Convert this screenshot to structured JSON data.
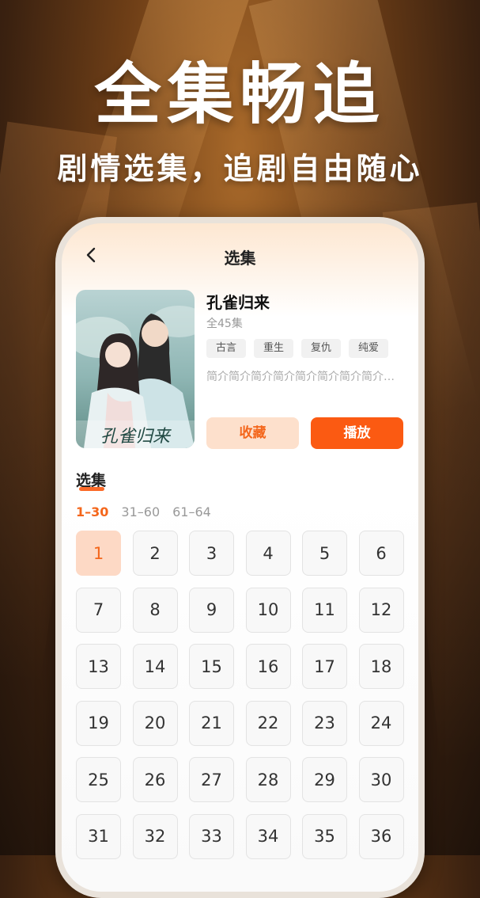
{
  "promo": {
    "title": "全集畅追",
    "subtitle": "剧情选集，追剧自由随心"
  },
  "nav": {
    "title": "选集",
    "back_icon": "chevron-left-icon"
  },
  "drama": {
    "title": "孔雀归来",
    "episodes": "全45集",
    "tags": [
      "古言",
      "重生",
      "复仇",
      "纯爱"
    ],
    "intro": "简介简介简介简介简介简介简介简介简介",
    "poster_caption": "孔雀归来"
  },
  "actions": {
    "favorite_label": "收藏",
    "play_label": "播放"
  },
  "episode_section": {
    "label": "选集",
    "ranges": [
      "1–30",
      "31–60",
      "61–64"
    ],
    "active_range": 0,
    "episodes": [
      "1",
      "2",
      "3",
      "4",
      "5",
      "6",
      "7",
      "8",
      "9",
      "10",
      "11",
      "12",
      "13",
      "14",
      "15",
      "16",
      "17",
      "18",
      "19",
      "20",
      "21",
      "22",
      "23",
      "24",
      "25",
      "26",
      "27",
      "28",
      "29",
      "30",
      "31",
      "32",
      "33",
      "34",
      "35",
      "36"
    ],
    "active_episode": 0
  },
  "colors": {
    "accent": "#fb5a12",
    "accent_light": "#fdd9c5"
  }
}
